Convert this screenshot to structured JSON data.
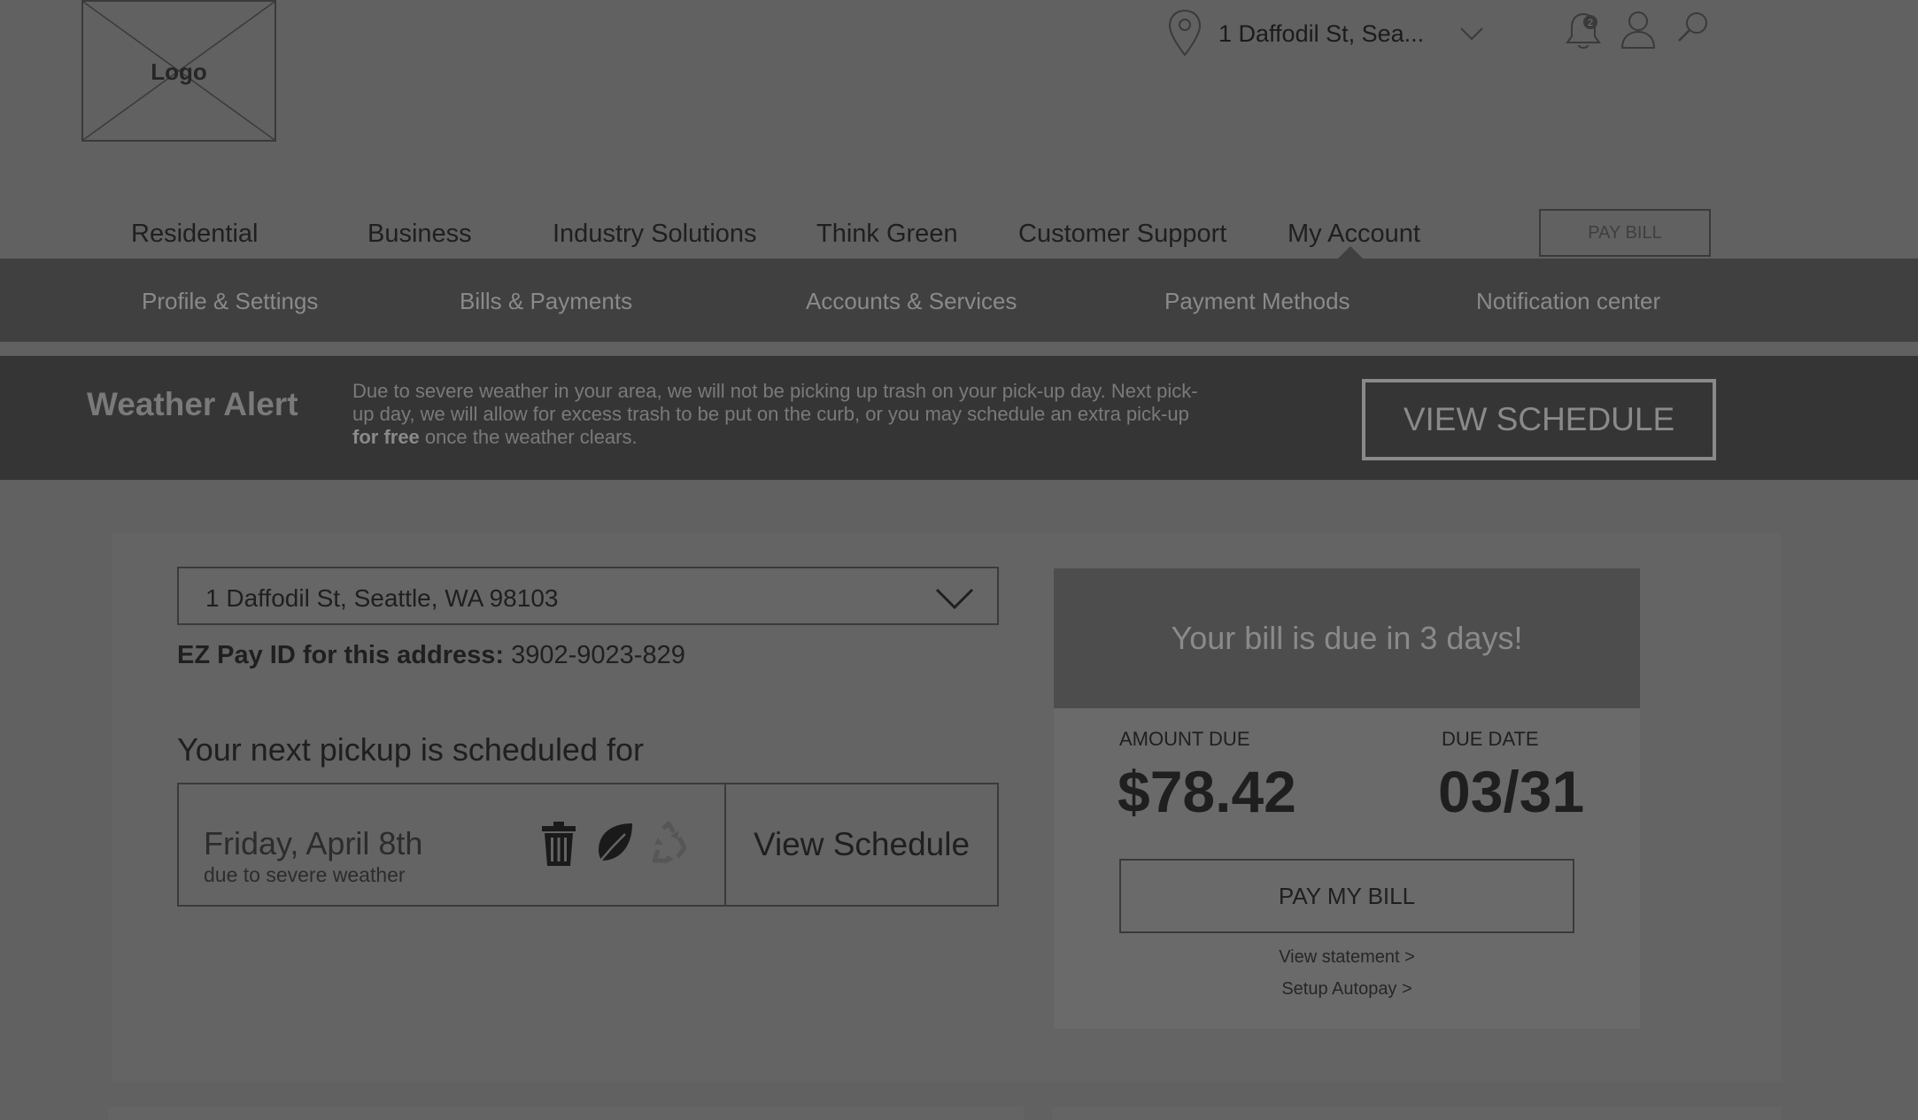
{
  "header": {
    "logo_text": "Logo",
    "location": "1 Daffodil St, Sea...",
    "notification_count": "2"
  },
  "nav": {
    "items": [
      {
        "label": "Residential"
      },
      {
        "label": "Business"
      },
      {
        "label": "Industry Solutions"
      },
      {
        "label": "Think Green"
      },
      {
        "label": "Customer Support"
      },
      {
        "label": "My Account",
        "active": true
      }
    ],
    "pay_bill_label": "PAY BILL"
  },
  "subnav": {
    "items": [
      {
        "label": "Profile & Settings"
      },
      {
        "label": "Bills & Payments"
      },
      {
        "label": "Accounts & Services"
      },
      {
        "label": "Payment Methods"
      },
      {
        "label": "Notification center"
      }
    ]
  },
  "alert": {
    "title": "Weather Alert",
    "body_before": "Due to severe weather in your area, we will not be picking up trash on your pick-up day. Next pick-up day, we will allow for excess trash to be put on the curb, or you may schedule an extra pick-up ",
    "body_bold": "for free",
    "body_after": " once the weather clears.",
    "button_label": "VIEW SCHEDULE"
  },
  "address": {
    "selected": "1 Daffodil St, Seattle, WA 98103",
    "ezpay_label": "EZ Pay ID for this address:",
    "ezpay_id": "3902-9023-829"
  },
  "pickup": {
    "heading": "Your next pickup is scheduled for",
    "date": "Friday, April 8th",
    "note": "due to severe weather",
    "icons": [
      "trash-icon",
      "leaf-icon",
      "recycle-icon"
    ],
    "button_label": "View Schedule"
  },
  "bill": {
    "banner": "Your bill is due in 3 days!",
    "amount_label": "AMOUNT DUE",
    "amount_value": "$78.42",
    "due_label": "DUE DATE",
    "due_value": "03/31",
    "pay_button": "PAY MY BILL",
    "statement_link": "View statement >",
    "autopay_link": "Setup Autopay >"
  },
  "colors": {
    "overlay_bg": "#616161",
    "subnav_bg": "#404040",
    "alert_bg": "#353535",
    "bill_banner_bg": "#4d4d4d"
  }
}
